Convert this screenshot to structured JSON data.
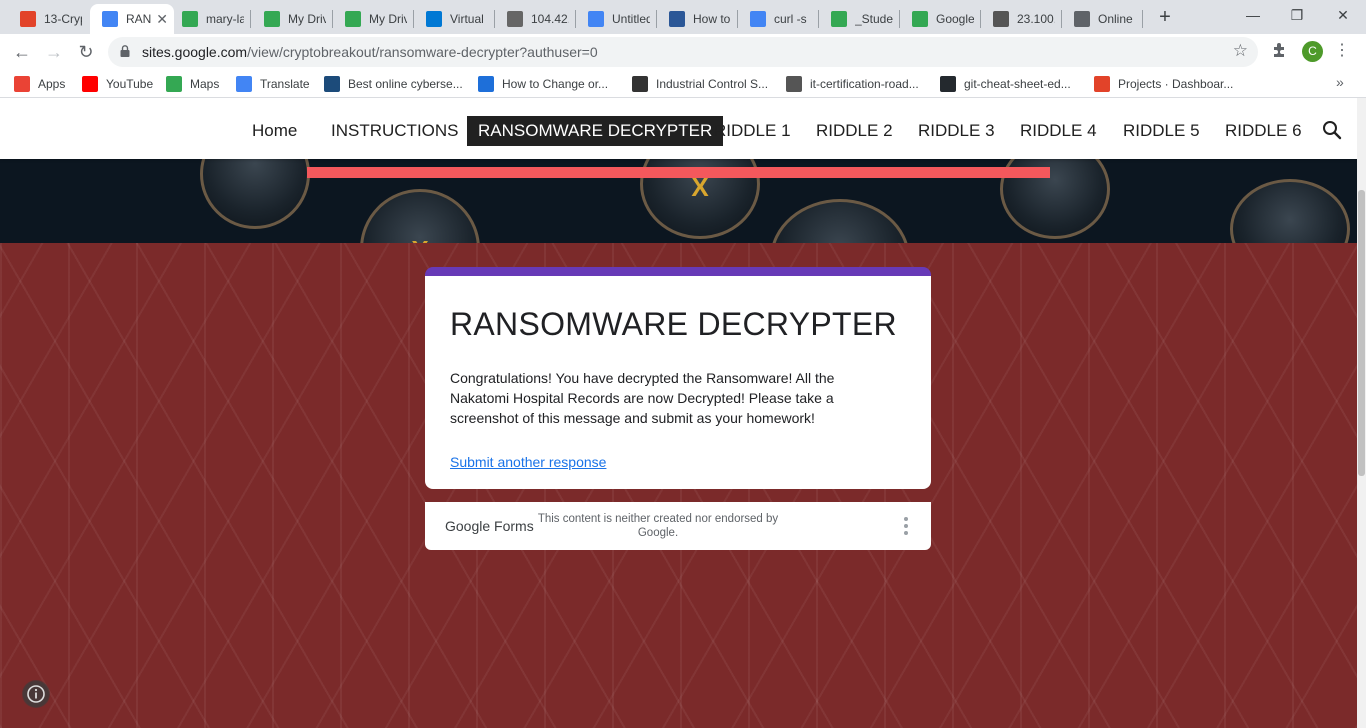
{
  "tabs": [
    {
      "title": "13-Cryp",
      "icon": "gitlab-icon",
      "color": "#e24329"
    },
    {
      "title": "RAN",
      "icon": "google-sites-icon",
      "color": "#4285f4",
      "active": true
    },
    {
      "title": "mary-la",
      "icon": "google-drive-icon",
      "color": "#34a853"
    },
    {
      "title": "My Driv",
      "icon": "google-drive-icon",
      "color": "#34a853"
    },
    {
      "title": "My Driv",
      "icon": "google-drive-icon",
      "color": "#34a853"
    },
    {
      "title": "Virtual",
      "icon": "azure-icon",
      "color": "#0078d4"
    },
    {
      "title": "104.42.",
      "icon": "server-icon",
      "color": "#666666"
    },
    {
      "title": "Untitled",
      "icon": "google-docs-icon",
      "color": "#4285f4"
    },
    {
      "title": "How to",
      "icon": "ut-icon",
      "color": "#2b5797"
    },
    {
      "title": "curl -s",
      "icon": "google-icon",
      "color": "#4285f4"
    },
    {
      "title": "_Studen",
      "icon": "google-drive-icon",
      "color": "#34a853"
    },
    {
      "title": "Google",
      "icon": "google-maps-icon",
      "color": "#34a853"
    },
    {
      "title": "23.100.",
      "icon": "kali-icon",
      "color": "#555555"
    },
    {
      "title": "Online",
      "icon": "globe-icon",
      "color": "#5f6368"
    }
  ],
  "tab_close_glyph": "✕",
  "new_tab_glyph": "+",
  "window": {
    "minimize": "—",
    "restore": "❐",
    "close": "✕"
  },
  "navbar": {
    "back": "←",
    "forward": "→",
    "reload": "↻",
    "url_host": "sites.google.com",
    "url_path": "/view/cryptobreakout/ransomware-decrypter?authuser=0",
    "star": "☆",
    "avatar_letter": "C",
    "menu": "⋮"
  },
  "bookmarks": [
    {
      "label": "Apps",
      "icon": "apps-grid-icon",
      "color": "#ea4335"
    },
    {
      "label": "YouTube",
      "icon": "youtube-icon",
      "color": "#ff0000"
    },
    {
      "label": "Maps",
      "icon": "google-maps-icon",
      "color": "#34a853"
    },
    {
      "label": "Translate",
      "icon": "google-translate-icon",
      "color": "#4285f4"
    },
    {
      "label": "Best online cyberse...",
      "icon": "tr-icon",
      "color": "#1c4b7a"
    },
    {
      "label": "How to Change or...",
      "icon": "lifewire-icon",
      "color": "#1e6fd9"
    },
    {
      "label": "Industrial Control S...",
      "icon": "dhs-seal-icon",
      "color": "#333333"
    },
    {
      "label": "it-certification-road...",
      "icon": "book-icon",
      "color": "#555555"
    },
    {
      "label": "git-cheat-sheet-ed...",
      "icon": "github-icon",
      "color": "#24292e"
    },
    {
      "label": "Projects · Dashboar...",
      "icon": "gitlab-icon",
      "color": "#e24329"
    }
  ],
  "bookmarks_more": "»",
  "site_nav": [
    {
      "label": "Home"
    },
    {
      "label": "INSTRUCTIONS"
    },
    {
      "label": "RANSOMWARE DECRYPTER",
      "active": true
    },
    {
      "label": "RIDDLE 1"
    },
    {
      "label": "RIDDLE 2"
    },
    {
      "label": "RIDDLE 3"
    },
    {
      "label": "RIDDLE 4"
    },
    {
      "label": "RIDDLE 5"
    },
    {
      "label": "RIDDLE 6"
    }
  ],
  "form": {
    "accent_color": "#673ab7",
    "title": "RANSOMWARE DECRYPTER",
    "message": "Congratulations!  You have decrypted the Ransomware!  All the Nakatomi Hospital Records are now Decrypted!  Please take a screenshot of this message and submit as your homework!",
    "link": "Submit another response"
  },
  "footer": {
    "brand_google": "Google",
    "brand_forms": "Forms",
    "disclaimer": "This content is neither created nor endorsed by Google."
  },
  "colors": {
    "banner_bar": "#f4585c",
    "page_bg": "#7b2a2a",
    "nav_active_bg": "#212121"
  }
}
